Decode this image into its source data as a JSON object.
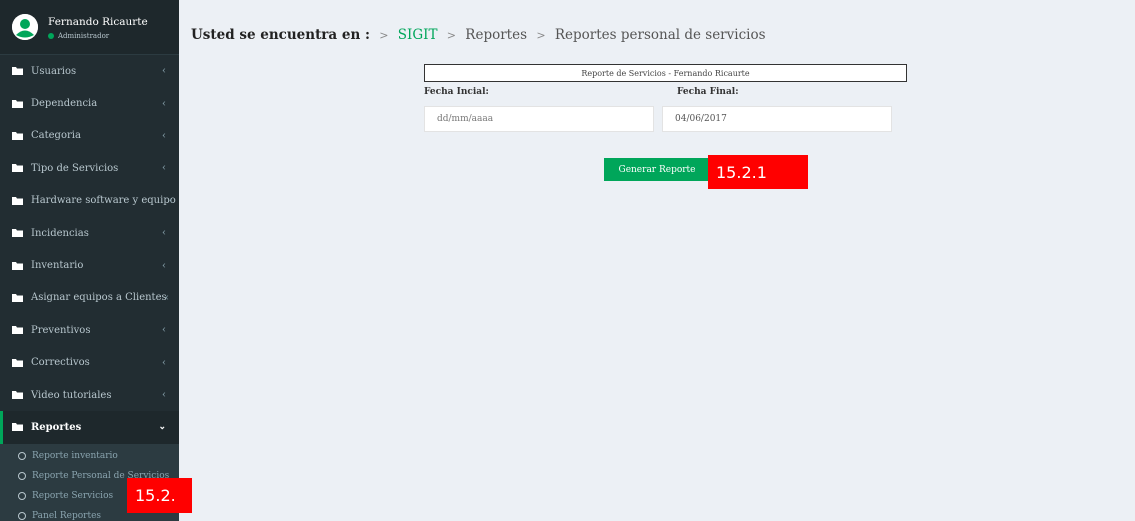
{
  "user": {
    "name": "Fernando Ricaurte",
    "role": "Administrador"
  },
  "menu": {
    "items": [
      {
        "label": "Usuarios"
      },
      {
        "label": "Dependencia"
      },
      {
        "label": "Categoria"
      },
      {
        "label": "Tipo de Servicios"
      },
      {
        "label": "Hardware software y equipo"
      },
      {
        "label": "Incidencias"
      },
      {
        "label": "Inventario"
      },
      {
        "label": "Asignar equipos a Clientes"
      },
      {
        "label": "Preventivos"
      },
      {
        "label": "Correctivos"
      },
      {
        "label": "Video tutoriales"
      }
    ],
    "active": {
      "label": "Reportes"
    },
    "sub": [
      {
        "label": "Reporte inventario"
      },
      {
        "label": "Reporte Personal de Servicios"
      },
      {
        "label": "Reporte Servicios"
      },
      {
        "label": "Panel Reportes"
      }
    ]
  },
  "breadcrumb": {
    "lead": "Usted se encuentra en :",
    "sep": ">",
    "items": [
      "SIGIT",
      "Reportes",
      "Reportes personal de servicios"
    ]
  },
  "report": {
    "title": "Reporte de Servicios - Fernando Ricaurte",
    "start_label": "Fecha Incial:",
    "start_placeholder": "dd/mm/aaaa",
    "end_label": "Fecha Final:",
    "end_value": "04/06/2017",
    "button": "Generar Reporte"
  },
  "callouts": {
    "button": "15.2.1",
    "menu": "15.2."
  },
  "colors": {
    "accent": "#00a65a",
    "sidebar": "#222d32",
    "callout": "#ff0000"
  }
}
